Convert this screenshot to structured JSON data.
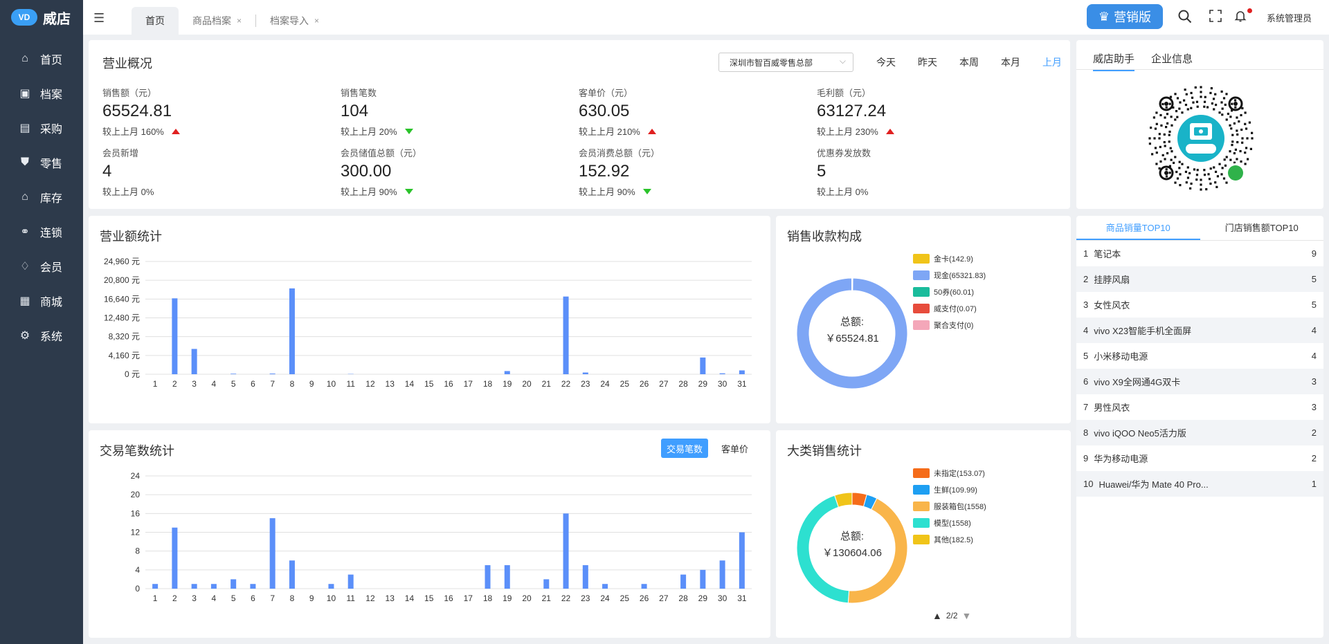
{
  "app": {
    "name": "威店",
    "logo_text": "VD"
  },
  "sidebar": {
    "items": [
      {
        "label": "首页",
        "icon": "home-icon"
      },
      {
        "label": "档案",
        "icon": "archive-icon"
      },
      {
        "label": "采购",
        "icon": "purchase-icon"
      },
      {
        "label": "零售",
        "icon": "retail-icon"
      },
      {
        "label": "库存",
        "icon": "warehouse-icon"
      },
      {
        "label": "连锁",
        "icon": "chain-icon"
      },
      {
        "label": "会员",
        "icon": "member-icon"
      },
      {
        "label": "商城",
        "icon": "mall-icon"
      },
      {
        "label": "系统",
        "icon": "settings-icon"
      }
    ]
  },
  "header": {
    "tabs": [
      {
        "label": "首页"
      },
      {
        "label": "商品档案"
      },
      {
        "label": "档案导入"
      }
    ],
    "promo_label": "营销版",
    "user": "系统管理员"
  },
  "overview": {
    "title": "营业概况",
    "store": "深圳市智百威零售总部",
    "ranges": [
      "今天",
      "昨天",
      "本周",
      "本月",
      "上月"
    ],
    "active_range": "上月",
    "metrics": [
      {
        "label": "销售额（元）",
        "value": "65524.81",
        "cmp": "较上上月  160%",
        "trend": "up"
      },
      {
        "label": "销售笔数",
        "value": "104",
        "cmp": "较上上月  20%",
        "trend": "down"
      },
      {
        "label": "客单价（元）",
        "value": "630.05",
        "cmp": "较上上月  210%",
        "trend": "up"
      },
      {
        "label": "毛利额（元）",
        "value": "63127.24",
        "cmp": "较上上月  230%",
        "trend": "up"
      },
      {
        "label": "会员新增",
        "value": "4",
        "cmp": "较上上月  0%",
        "trend": "none"
      },
      {
        "label": "会员储值总额（元）",
        "value": "300.00",
        "cmp": "较上上月  90%",
        "trend": "down"
      },
      {
        "label": "会员消费总额（元）",
        "value": "152.92",
        "cmp": "较上上月  90%",
        "trend": "down"
      },
      {
        "label": "优惠券发放数",
        "value": "5",
        "cmp": "较上上月  0%",
        "trend": "none"
      }
    ]
  },
  "helper": {
    "tabs": [
      "威店助手",
      "企业信息"
    ]
  },
  "revenue_chart": {
    "title": "营业额统计"
  },
  "trades_chart": {
    "title": "交易笔数统计",
    "buttons": [
      "交易笔数",
      "客单价"
    ]
  },
  "payment": {
    "title": "销售收款构成",
    "center_label": "总额:",
    "center_value": "￥65524.81",
    "legend": [
      {
        "label": "金卡(142.9)",
        "value": 142.9,
        "color": "#f0c419"
      },
      {
        "label": "现金(65321.83)",
        "value": 65321.83,
        "color": "#7ea6f5"
      },
      {
        "label": "50券(60.01)",
        "value": 60.01,
        "color": "#1abc9c"
      },
      {
        "label": "威支付(0.07)",
        "value": 0.07,
        "color": "#e74c3c"
      },
      {
        "label": "聚合支付(0)",
        "value": 0,
        "color": "#f4a7b9"
      }
    ]
  },
  "category": {
    "title": "大类销售统计",
    "center_label": "总额:",
    "center_value": "￥130604.06",
    "legend": [
      {
        "label": "未指定(153.07)",
        "value": 153.07,
        "color": "#f56c1a"
      },
      {
        "label": "生鲜(109.99)",
        "value": 109.99,
        "color": "#1e9ff2"
      },
      {
        "label": "服装箱包(1558)",
        "value": 1558,
        "color": "#f9b54a"
      },
      {
        "label": "模型(1558)",
        "value": 1558,
        "color": "#2de0d0"
      },
      {
        "label": "其他(182.5)",
        "value": 182.5,
        "color": "#f0c419"
      }
    ],
    "pager": "2/2"
  },
  "top10": {
    "tabs": [
      "商品销量TOP10",
      "门店销售额TOP10"
    ],
    "rows": [
      {
        "rank": "1",
        "name": "笔记本",
        "count": "9"
      },
      {
        "rank": "2",
        "name": "挂脖风扇",
        "count": "5"
      },
      {
        "rank": "3",
        "name": "女性风衣",
        "count": "5"
      },
      {
        "rank": "4",
        "name": "vivo X23智能手机全面屏",
        "count": "4"
      },
      {
        "rank": "5",
        "name": "小米移动电源",
        "count": "4"
      },
      {
        "rank": "6",
        "name": "vivo X9全网通4G双卡",
        "count": "3"
      },
      {
        "rank": "7",
        "name": "男性风衣",
        "count": "3"
      },
      {
        "rank": "8",
        "name": "vivo iQOO Neo5活力版",
        "count": "2"
      },
      {
        "rank": "9",
        "name": "华为移动电源",
        "count": "2"
      },
      {
        "rank": "10",
        "name": "Huawei/华为 Mate 40 Pro...",
        "count": "1"
      }
    ]
  },
  "chart_data": [
    {
      "type": "bar",
      "unit": "元",
      "categories": [
        "1",
        "2",
        "3",
        "4",
        "5",
        "6",
        "7",
        "8",
        "9",
        "10",
        "11",
        "12",
        "13",
        "14",
        "15",
        "16",
        "17",
        "18",
        "19",
        "20",
        "21",
        "22",
        "23",
        "24",
        "25",
        "26",
        "27",
        "28",
        "29",
        "30",
        "31"
      ],
      "values": [
        0,
        16800,
        5600,
        0,
        120,
        0,
        150,
        19000,
        0,
        0,
        60,
        0,
        0,
        0,
        0,
        0,
        0,
        0,
        700,
        0,
        0,
        17200,
        380,
        0,
        0,
        0,
        0,
        0,
        3700,
        200,
        850
      ],
      "y_ticks": [
        "0 元",
        "4,160 元",
        "8,320 元",
        "12,480 元",
        "16,640 元",
        "20,800 元",
        "24,960 元"
      ],
      "ylim": [
        0,
        24960
      ],
      "color": "#5b8ff9"
    },
    {
      "type": "bar",
      "categories": [
        "1",
        "2",
        "3",
        "4",
        "5",
        "6",
        "7",
        "8",
        "9",
        "10",
        "11",
        "12",
        "13",
        "14",
        "15",
        "16",
        "17",
        "18",
        "19",
        "20",
        "21",
        "22",
        "23",
        "24",
        "25",
        "26",
        "27",
        "28",
        "29",
        "30",
        "31"
      ],
      "values": [
        1,
        13,
        1,
        1,
        2,
        1,
        15,
        6,
        0,
        1,
        3,
        0,
        0,
        0,
        0,
        0,
        0,
        5,
        5,
        0,
        2,
        16,
        5,
        1,
        0,
        1,
        0,
        3,
        4,
        6,
        12
      ],
      "y_ticks": [
        "0",
        "4",
        "8",
        "12",
        "16",
        "20",
        "24"
      ],
      "ylim": [
        0,
        24
      ],
      "color": "#5b8ff9"
    }
  ]
}
